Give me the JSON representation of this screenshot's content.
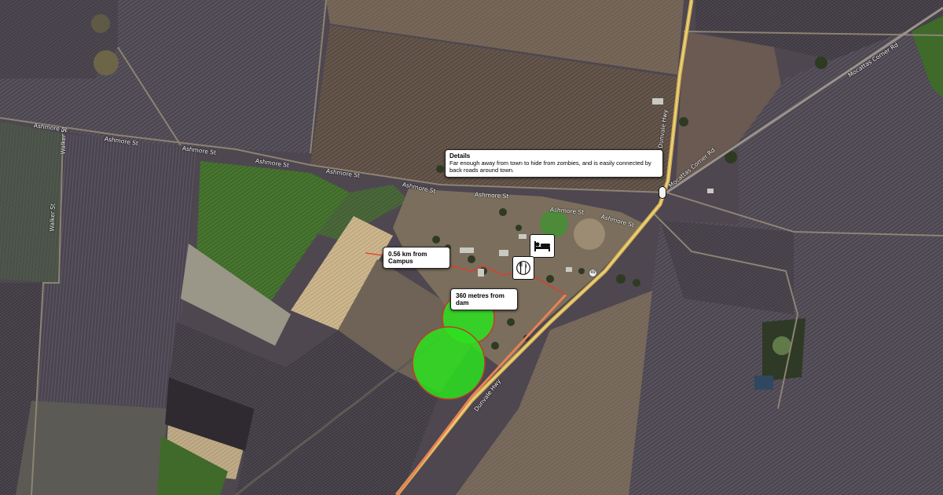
{
  "map": {
    "road_labels": [
      "Ashmore St",
      "Ashmore St",
      "Ashmore St",
      "Ashmore St",
      "Ashmore St",
      "Ashmore St",
      "Ashmore St",
      "Ashmore St",
      "Ashmore St",
      "Walker St",
      "Walker St",
      "Mocattas Corner Rd",
      "Mocattas Corner Rd",
      "Dunvale Hwy",
      "Dunvale Hwy"
    ],
    "highway_shield": "49",
    "icons": {
      "lodging": "bed-icon",
      "dining": "fork-knife-icon",
      "marker": "place-pin-icon"
    },
    "zones_color": "#2be21f",
    "route_color": "#ee3524"
  },
  "callouts": {
    "details": {
      "title": "Details",
      "text": "Far enough away from town to hide from zombies, and is easily connected by back roads around town."
    },
    "distance_campus": "0.56 km from Campus",
    "distance_dam": "360 metres from dam"
  }
}
